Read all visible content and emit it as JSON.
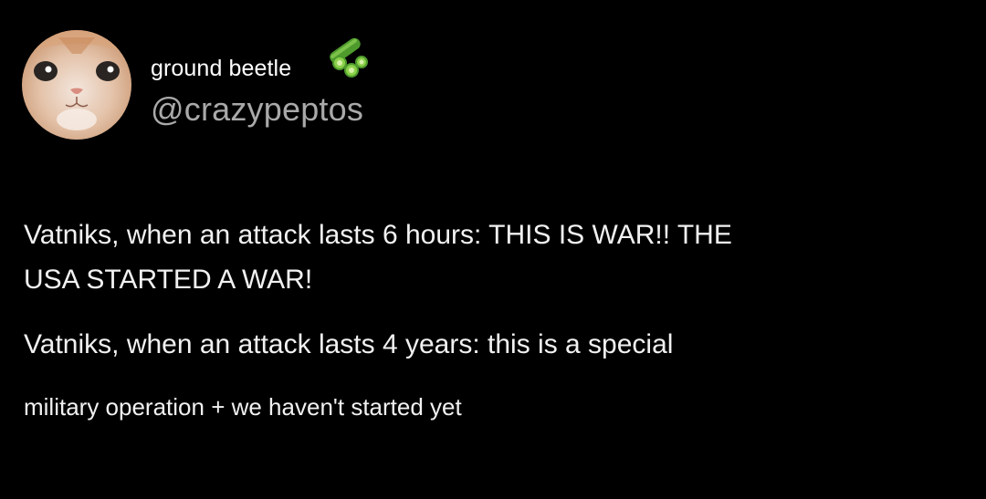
{
  "post": {
    "author": {
      "display_name": "ground beetle",
      "handle": "@crazypeptos",
      "avatar_icon": "kitten-avatar",
      "name_emoji": "cucumber-icon"
    },
    "body": {
      "line_1": "Vatniks, when an attack lasts 6 hours: THIS IS WAR!! THE",
      "line_2": "USA STARTED A WAR!",
      "line_3": "Vatniks, when an attack lasts 4 years: this is a special",
      "line_4": "military operation + we haven't started yet"
    }
  },
  "colors": {
    "background": "#000000",
    "text": "#f1f1f1",
    "handle": "#a9a9a9",
    "emoji_green": "#8bd14a"
  }
}
